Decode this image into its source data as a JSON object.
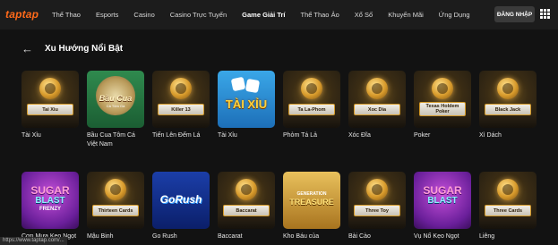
{
  "logo": {
    "part1": "tap",
    "part2": "tap"
  },
  "nav": {
    "items": [
      {
        "label": "Thể Thao"
      },
      {
        "label": "Esports"
      },
      {
        "label": "Casino"
      },
      {
        "label": "Casino Trực Tuyến"
      },
      {
        "label": "Game Giải Trí",
        "active": true
      },
      {
        "label": "Thể Thao Ảo"
      },
      {
        "label": "Xổ Số"
      },
      {
        "label": "Khuyến Mãi"
      },
      {
        "label": "Ứng Dụng"
      }
    ],
    "login_label": "ĐĂNG NHẬP"
  },
  "section": {
    "back_icon": "arrow-left-icon",
    "title": "Xu Hướng Nổi Bật"
  },
  "games_row1": [
    {
      "name": "Tài Xỉu",
      "plate": "Tai Xiu",
      "style": "generic"
    },
    {
      "name": "Bầu Cua Tôm Cá Việt Nam",
      "style": "baucua",
      "art_title": "Bầu Cua",
      "art_sub": "Cá Tôm Gà"
    },
    {
      "name": "Tiến Lên Đếm Lá",
      "plate": "Killer 13",
      "style": "generic"
    },
    {
      "name": "Tài Xỉu",
      "style": "taixiu",
      "art_title": "TÀI XỈU"
    },
    {
      "name": "Phỏm Tá Lả",
      "plate": "Ta La-Phom",
      "style": "generic"
    },
    {
      "name": "Xóc Đĩa",
      "plate": "Xoc Dia",
      "style": "generic"
    },
    {
      "name": "Poker",
      "plate": "Texas Holdem Poker",
      "style": "generic"
    },
    {
      "name": "Xì Dách",
      "plate": "Black Jack",
      "style": "generic"
    }
  ],
  "games_row2": [
    {
      "name": "Cơn Mưa Kẹo Ngọt",
      "style": "sugar",
      "art_title": "SUGAR",
      "art_title2": "BLAST",
      "art_sub": "FRENZY"
    },
    {
      "name": "Mậu Binh",
      "plate": "Thirteen Cards",
      "style": "generic"
    },
    {
      "name": "Go Rush",
      "style": "gorush",
      "art_title": "GoRush"
    },
    {
      "name": "Baccarat",
      "plate": "Baccarat",
      "style": "generic"
    },
    {
      "name": "Kho Báu của",
      "style": "treasure",
      "art_sub": "GENERATION",
      "art_title": "TREASURE"
    },
    {
      "name": "Bài Cào",
      "plate": "Three Toy",
      "style": "generic"
    },
    {
      "name": "Vụ Nổ Kẹo Ngọt",
      "style": "sugar",
      "art_title": "SUGAR",
      "art_title2": "BLAST",
      "art_sub": ""
    },
    {
      "name": "Liêng",
      "plate": "Three Cards",
      "style": "generic"
    }
  ],
  "status_url": "https://www.taptap.com/..."
}
